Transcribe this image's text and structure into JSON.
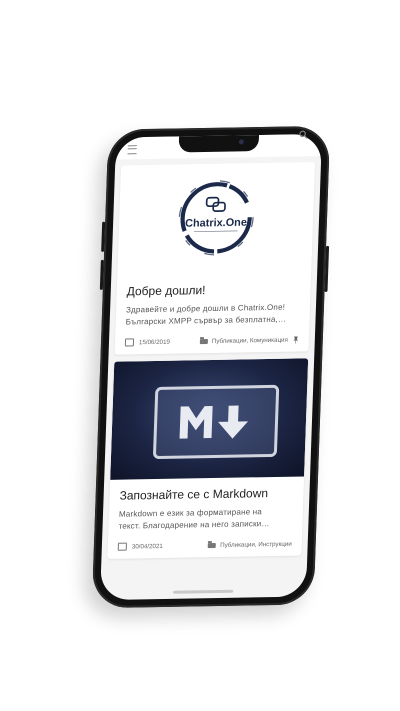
{
  "site": {
    "logo_text": "Chatrix.One"
  },
  "posts": [
    {
      "title": "Добре дошли!",
      "excerpt_line1": "Здравейте и добре дошли в Chatrix.One!",
      "excerpt_line2": "Български XMPP сървър за безплатна,…",
      "date": "15/06/2019",
      "categories": "Публикации, Комуникация",
      "pinned": true
    },
    {
      "title": "Запознайте се с Markdown",
      "excerpt_line1": "Markdown е език за форматиране на",
      "excerpt_line2": "текст. Благодарение на него записки…",
      "date": "30/04/2021",
      "categories": "Публикации, Инструкции"
    }
  ],
  "colors": {
    "logo_navy": "#1b2a4a",
    "markdown_bg": "#1c2544",
    "markdown_border": "#cfd4de"
  }
}
